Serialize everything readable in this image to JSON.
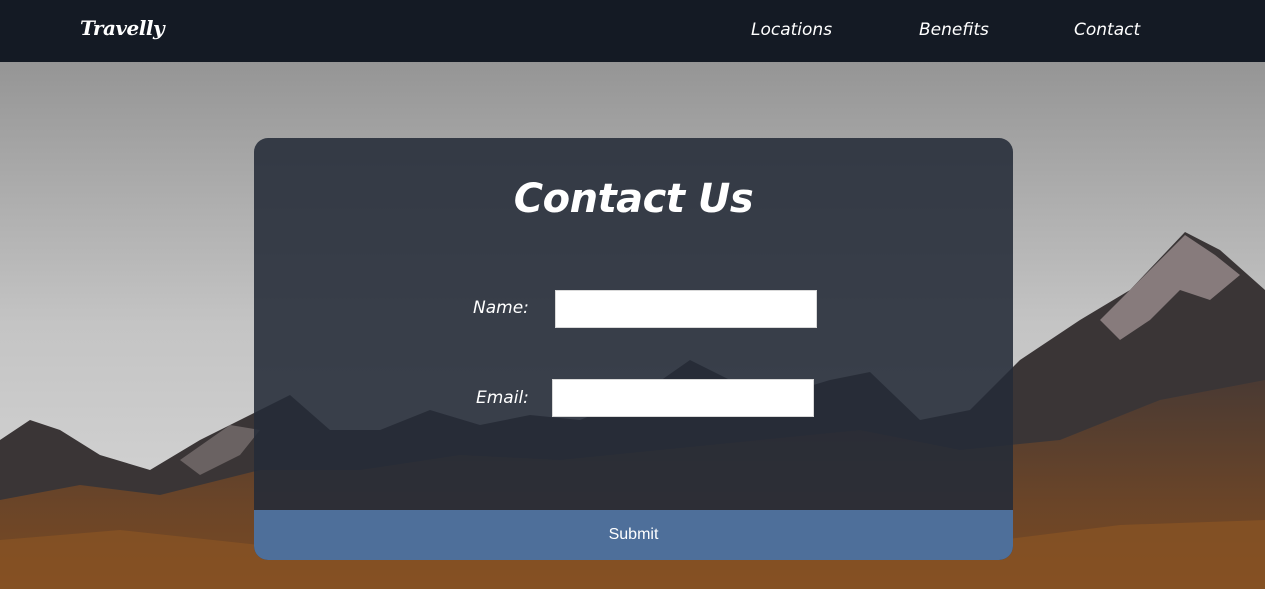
{
  "navbar": {
    "logo": "Travelly",
    "links": [
      {
        "label": "Locations"
      },
      {
        "label": "Benefits"
      },
      {
        "label": "Contact"
      }
    ]
  },
  "contact_form": {
    "title": "Contact Us",
    "name_label": "Name:",
    "name_value": "",
    "email_label": "Email:",
    "email_value": "",
    "submit_label": "Submit"
  },
  "colors": {
    "navbar_bg": "#141a24",
    "card_bg": "#242b38",
    "submit_bg": "#4e6f9a",
    "text": "#ffffff"
  }
}
